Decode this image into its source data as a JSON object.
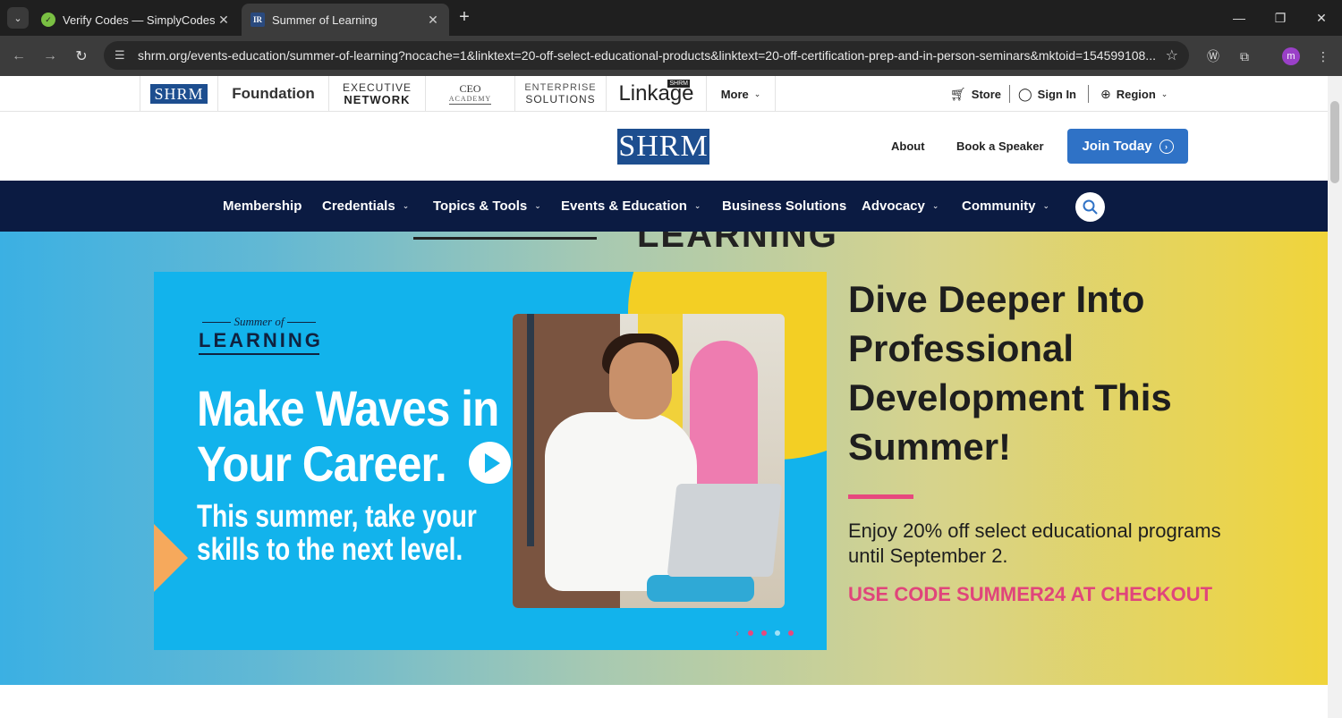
{
  "browser": {
    "tabs": [
      {
        "title": "Verify Codes — SimplyCodes",
        "active": false
      },
      {
        "title": "Summer of Learning",
        "active": true
      }
    ],
    "url": "shrm.org/events-education/summer-of-learning?nocache=1&linktext=20-off-select-educational-products&linktext=20-off-certification-prep-and-in-person-seminars&mktoid=154599108...",
    "profile_initial": "m"
  },
  "family_bar": {
    "brands": {
      "shrm": "SHRM",
      "foundation": "Foundation",
      "executive_l1": "EXECUTIVE",
      "executive_l2": "NETWORK",
      "ceo_l1": "CEO",
      "ceo_l2": "ACADEMY",
      "enterprise_l1": "ENTERPRISE",
      "enterprise_l2": "SOLUTIONS",
      "linkage": "Linkage",
      "linkage_tag": "SHRM"
    },
    "more": "More",
    "store": "Store",
    "sign_in": "Sign In",
    "region": "Region"
  },
  "header": {
    "logo": "SHRM",
    "about": "About",
    "speaker": "Book a Speaker",
    "join": "Join Today"
  },
  "nav": {
    "items": [
      {
        "label": "Membership",
        "has_menu": false
      },
      {
        "label": "Credentials",
        "has_menu": true
      },
      {
        "label": "Topics & Tools",
        "has_menu": true
      },
      {
        "label": "Events & Education",
        "has_menu": true
      },
      {
        "label": "Business Solutions",
        "has_menu": false
      },
      {
        "label": "Advocacy",
        "has_menu": true
      },
      {
        "label": "Community",
        "has_menu": true
      }
    ]
  },
  "hero": {
    "top_text": "LEARNING",
    "video": {
      "script_label": "Summer of",
      "program_label": "LEARNING",
      "headline": "Make Waves in Your Career.",
      "subline": "This summer, take your skills to the next level."
    },
    "title": "Dive Deeper Into Professional Development This Summer!",
    "body": "Enjoy 20% off select educational programs until September 2.",
    "code": "USE CODE SUMMER24 AT CHECKOUT"
  },
  "colors": {
    "navy": "#0b1b42",
    "brand_blue": "#1d4e8f",
    "join_blue": "#2f72c6",
    "pink": "#e0457b",
    "video_blue": "#12b3ec"
  }
}
